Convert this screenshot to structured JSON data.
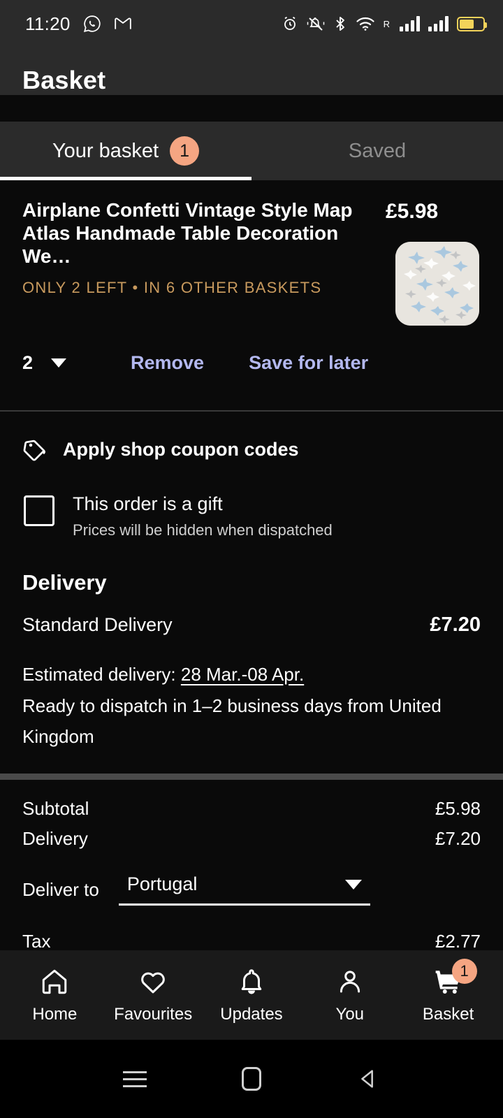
{
  "statusbar": {
    "time": "11:20",
    "left_icons": [
      "whatsapp-icon",
      "gmail-icon"
    ],
    "right_icons": [
      "alarm-icon",
      "mute-icon",
      "bluetooth-icon",
      "wifi-icon",
      "signal-roaming-icon",
      "signal-icon",
      "battery-icon"
    ],
    "roaming_label": "R"
  },
  "header": {
    "title": "Basket"
  },
  "tabs": [
    {
      "label": "Your basket",
      "badge": "1",
      "active": true
    },
    {
      "label": "Saved",
      "badge": "",
      "active": false
    }
  ],
  "item": {
    "title": "Airplane Confetti Vintage Style Map Atlas Handmade Table Decoration We…",
    "price": "£5.98",
    "scarcity": "ONLY 2 LEFT • IN 6 OTHER BASKETS",
    "quantity": "2",
    "remove_label": "Remove",
    "save_label": "Save for later",
    "thumbnail_alt": "airplane-confetti-product-photo"
  },
  "coupon": {
    "label": "Apply shop coupon codes",
    "icon": "tag-icon"
  },
  "gift": {
    "checked": false,
    "title": "This order is a gift",
    "subtitle": "Prices will be hidden when dispatched"
  },
  "delivery": {
    "heading": "Delivery",
    "method": "Standard Delivery",
    "price": "£7.20",
    "estimate_prefix": "Estimated delivery: ",
    "estimate_dates": "28 Mar.-08 Apr.",
    "dispatch_note": "Ready to dispatch in 1–2 business days from United Kingdom"
  },
  "totals": {
    "subtotal_label": "Subtotal",
    "subtotal_value": "£5.98",
    "delivery_label": "Delivery",
    "delivery_value": "£7.20",
    "deliver_to_label": "Deliver to",
    "deliver_to_value": "Portugal",
    "tax_label": "Tax",
    "tax_value": "£2.77"
  },
  "bottom_nav": [
    {
      "label": "Home",
      "icon": "home-icon",
      "badge": ""
    },
    {
      "label": "Favourites",
      "icon": "heart-icon",
      "badge": ""
    },
    {
      "label": "Updates",
      "icon": "bell-icon",
      "badge": ""
    },
    {
      "label": "You",
      "icon": "person-icon",
      "badge": ""
    },
    {
      "label": "Basket",
      "icon": "cart-icon",
      "badge": "1"
    }
  ],
  "android_nav": [
    "recents-icon",
    "home-square-icon",
    "back-icon"
  ],
  "colors": {
    "accent_badge": "#f5a582",
    "link": "#b3b8ef",
    "scarcity": "#c89a5e",
    "background": "#0a0a0a",
    "header_bg": "#2b2b2b",
    "battery": "#f2d35a"
  }
}
